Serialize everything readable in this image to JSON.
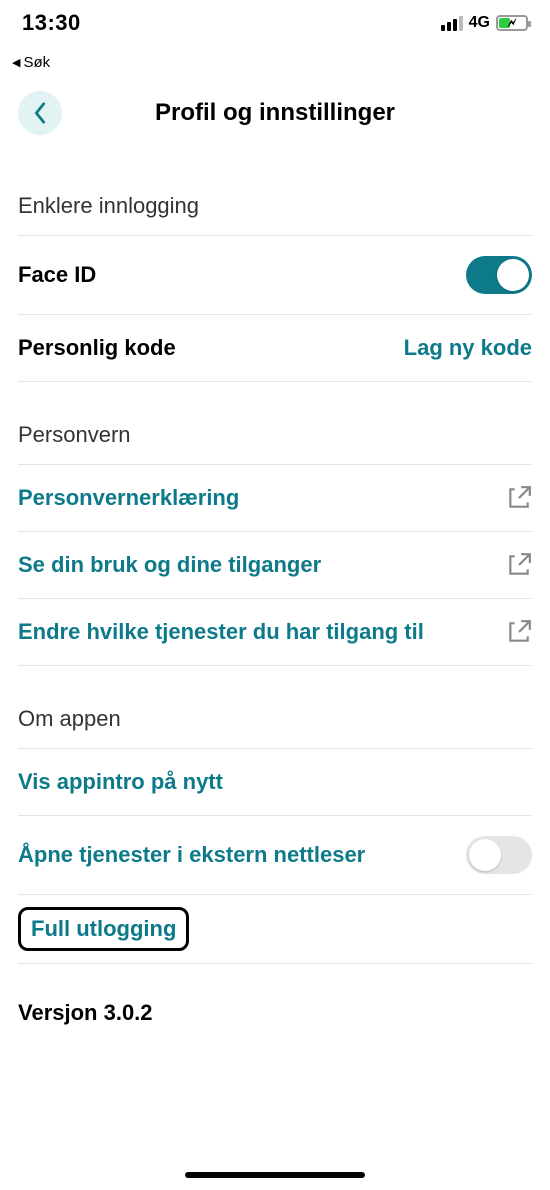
{
  "statusbar": {
    "time": "13:30",
    "back_breadcrumb": "Søk",
    "network": "4G"
  },
  "header": {
    "title": "Profil og innstillinger"
  },
  "sections": {
    "login": {
      "header": "Enklere innlogging",
      "face_id_label": "Face ID",
      "face_id_on": true,
      "personal_code_label": "Personlig kode",
      "personal_code_action": "Lag ny kode"
    },
    "privacy": {
      "header": "Personvern",
      "privacy_policy": "Personvernerklæring",
      "usage_access": "Se din bruk og dine tilganger",
      "change_services": "Endre hvilke tjenester du har tilgang til"
    },
    "about": {
      "header": "Om appen",
      "show_intro": "Vis appintro på nytt",
      "external_browser_label": "Åpne tjenester i ekstern nettleser",
      "external_browser_on": false,
      "full_logout": "Full utlogging"
    }
  },
  "version": "Versjon 3.0.2"
}
